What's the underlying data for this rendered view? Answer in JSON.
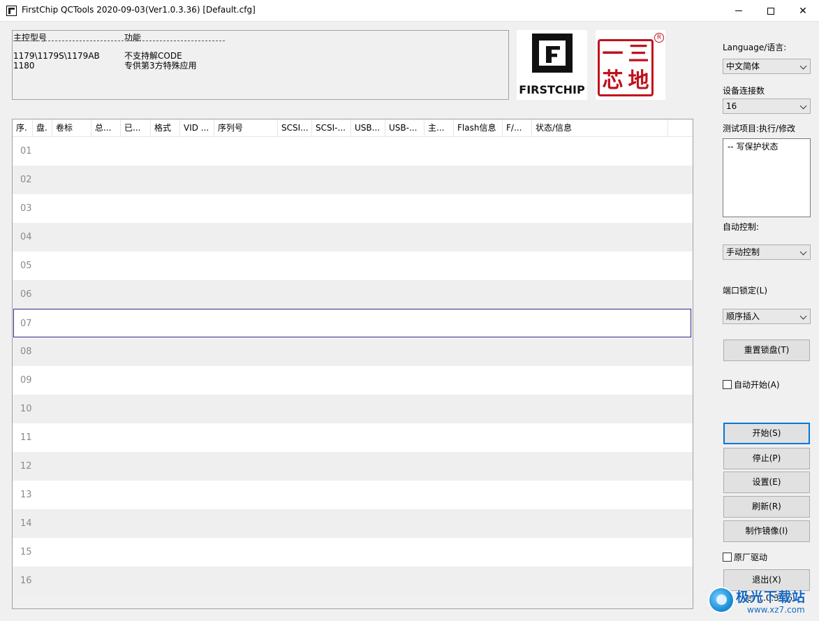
{
  "window": {
    "title": "FirstChip QCTools 2020-09-03(Ver1.0.3.36) [Default.cfg]"
  },
  "info_panel": {
    "col1_header": "主控型号",
    "col2_header": "功能",
    "rows": [
      {
        "model": "1179\\1179S\\1179AB",
        "feature": "不支持解CODE"
      },
      {
        "model": "1180",
        "feature": "专供第3方特殊应用"
      }
    ]
  },
  "logos": {
    "firstchip_text": "FIRSTCHIP",
    "seal_chars": [
      "三",
      "一",
      "地",
      "芯"
    ],
    "seal_registered": "R"
  },
  "table": {
    "columns": [
      "序.",
      "盘.",
      "卷标",
      "总...",
      "已...",
      "格式",
      "VID ...",
      "序列号",
      "SCSI...",
      "SCSI-...",
      "USB...",
      "USB-...",
      "主...",
      "Flash信息",
      "F/...",
      "状态/信息"
    ],
    "rows": [
      "01",
      "02",
      "03",
      "04",
      "05",
      "06",
      "07",
      "08",
      "09",
      "10",
      "11",
      "12",
      "13",
      "14",
      "15",
      "16"
    ],
    "selected_row": "07"
  },
  "right_panel": {
    "language_label": "Language/语言:",
    "language_value": "中文简体",
    "device_count_label": "设备连接数",
    "device_count_value": "16",
    "test_items_label": "测试项目:执行/修改",
    "test_items": [
      "-- 写保护状态"
    ],
    "auto_control_label": "自动控制:",
    "auto_control_value": "手动控制",
    "port_lock_label": "端口锁定(L)",
    "port_lock_value": "顺序插入",
    "reset_lock_button": "重置锁盘(T)",
    "auto_start_label": "自动开始(A)",
    "auto_start_checked": false,
    "start_button": "开始(S)",
    "stop_button": "停止(P)",
    "settings_button": "设置(E)",
    "refresh_button": "刷新(R)",
    "make_image_button": "制作镜像(I)",
    "original_driver_label": "原厂驱动",
    "original_driver_checked": false,
    "exit_button": "退出(X)",
    "version": "Ver 1.0.3.36"
  },
  "watermark": {
    "title": "极光下载站",
    "subtitle": "www.xz7.com"
  }
}
